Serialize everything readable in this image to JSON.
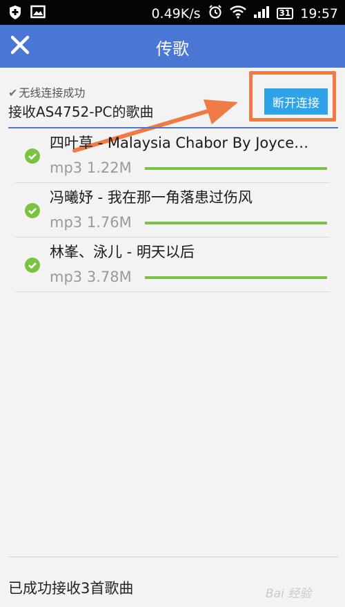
{
  "status_bar": {
    "left_icons": [
      "shield-plus-icon",
      "image-icon"
    ],
    "net_speed": "0.49K/s",
    "calendar_day": "31",
    "time": "19:57",
    "right_icons": [
      "alarm-icon",
      "wifi-icon",
      "signal-icon",
      "calendar-icon"
    ]
  },
  "header": {
    "title": "传歌",
    "close_icon": "close-icon",
    "background": "#4a76d4"
  },
  "connection": {
    "status_text": "无线连接成功",
    "receiving_text": "接收AS4752-PC的歌曲",
    "disconnect_label": "断开连接",
    "highlight_color": "#ef7a43"
  },
  "songs": [
    {
      "title": "四叶草 - Malaysia Chabor By Joyce…",
      "format": "mp3",
      "size": "1.22M",
      "progress": 1.0
    },
    {
      "title": "冯曦妤 - 我在那一角落患过伤风",
      "format": "mp3",
      "size": "1.76M",
      "progress": 1.0
    },
    {
      "title": "林峯、泳儿 - 明天以后",
      "format": "mp3",
      "size": "3.78M",
      "progress": 1.0
    }
  ],
  "footer": {
    "summary": "已成功接收3首歌曲"
  },
  "watermark": "Bai 经验",
  "colors": {
    "accent": "#2ea3e8",
    "success": "#7cc242"
  }
}
